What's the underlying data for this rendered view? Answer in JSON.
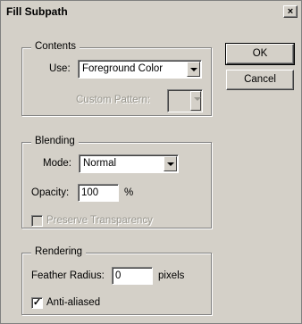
{
  "window": {
    "title": "Fill Subpath",
    "close_glyph": "×"
  },
  "contents": {
    "legend": "Contents",
    "use_label": "Use:",
    "use_value": "Foreground Color",
    "custom_pattern_label": "Custom Pattern:"
  },
  "blending": {
    "legend": "Blending",
    "mode_label": "Mode:",
    "mode_value": "Normal",
    "opacity_label": "Opacity:",
    "opacity_value": "100",
    "opacity_unit": "%",
    "preserve_transparency_label": "Preserve Transparency",
    "preserve_transparency_checked": false
  },
  "rendering": {
    "legend": "Rendering",
    "feather_label": "Feather Radius:",
    "feather_value": "0",
    "feather_unit": "pixels",
    "anti_aliased_label": "Anti-aliased",
    "anti_aliased_checked": true,
    "check_glyph": "✓"
  },
  "buttons": {
    "ok": "OK",
    "cancel": "Cancel"
  }
}
